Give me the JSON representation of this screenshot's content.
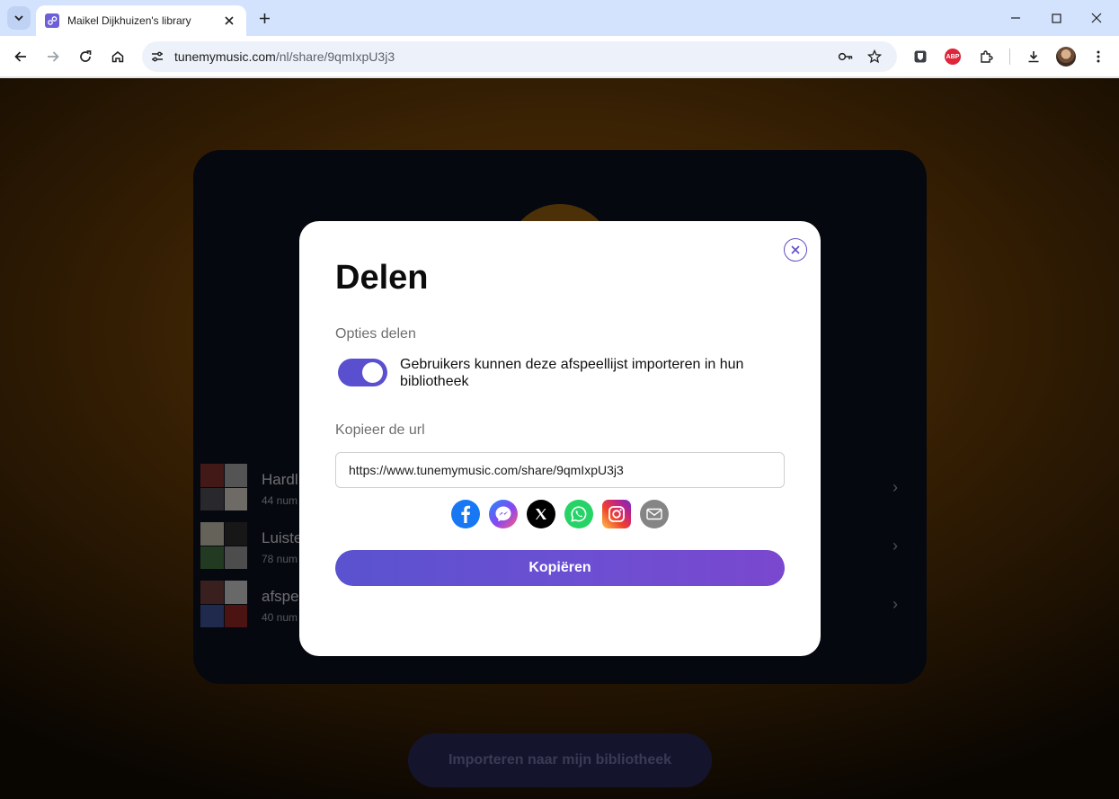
{
  "browser": {
    "tab_title": "Maikel Dijkhuizen's library",
    "url_host": "tunemymusic.com",
    "url_path": "/nl/share/9qmIxpU3j3",
    "extensions": {
      "abp_label": "ABP"
    }
  },
  "background": {
    "playlists": [
      {
        "title": "Hardl",
        "subtitle": "44 num"
      },
      {
        "title": "Luiste",
        "subtitle": "78 num"
      },
      {
        "title": "afspe",
        "subtitle": "40 num"
      }
    ],
    "import_button": "Importeren naar mijn bibliotheek"
  },
  "modal": {
    "title": "Delen",
    "share_options_label": "Opties delen",
    "toggle_on": true,
    "toggle_text": "Gebruikers kunnen deze afspeellijst importeren in hun bibliotheek",
    "copy_url_label": "Kopieer de url",
    "url_value": "https://www.tunemymusic.com/share/9qmIxpU3j3",
    "share_targets": [
      "facebook",
      "messenger",
      "x",
      "whatsapp",
      "instagram",
      "email"
    ],
    "copy_button": "Kopiëren"
  },
  "colors": {
    "accent": "#5a4fcf",
    "card_bg": "#0b0f1c",
    "chrome_bg": "#d3e3fd"
  }
}
